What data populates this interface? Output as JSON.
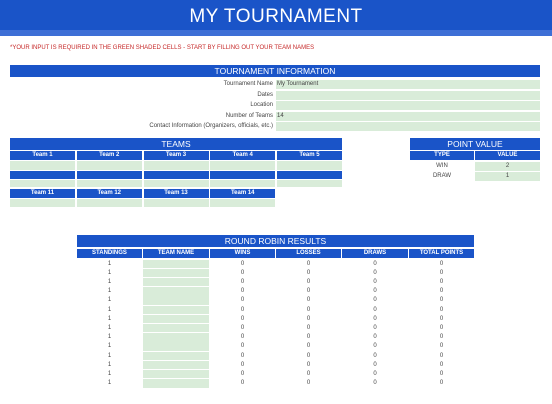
{
  "title": "MY TOURNAMENT",
  "instruction": "*YOUR INPUT IS REQUIRED IN THE GREEN SHADED CELLS - START BY FILLING OUT YOUR TEAM NAMES",
  "info": {
    "header": "TOURNAMENT INFORMATION",
    "rows": [
      {
        "label": "Tournament Name",
        "value": "My Tournament"
      },
      {
        "label": "Dates",
        "value": ""
      },
      {
        "label": "Location",
        "value": ""
      },
      {
        "label": "Number of Teams",
        "value": "14"
      },
      {
        "label": "Contact Information (Organizers, officials, etc.)",
        "value": ""
      }
    ]
  },
  "teams": {
    "header": "TEAMS",
    "row1": [
      "Team 1",
      "Team 2",
      "Team 3",
      "Team 4",
      "Team 5"
    ],
    "row3": [
      "Team 11",
      "Team 12",
      "Team 13",
      "Team 14"
    ]
  },
  "points": {
    "header": "POINT VALUE",
    "col_type": "TYPE",
    "col_value": "VALUE",
    "rows": [
      {
        "type": "WIN",
        "value": "2"
      },
      {
        "type": "DRAW",
        "value": "1"
      }
    ]
  },
  "results": {
    "header": "ROUND ROBIN RESULTS",
    "columns": [
      "STANDINGS",
      "TEAM NAME",
      "WINS",
      "LOSSES",
      "DRAWS",
      "TOTAL POINTS"
    ],
    "rows": [
      [
        "1",
        "",
        "0",
        "0",
        "0",
        "0"
      ],
      [
        "1",
        "",
        "0",
        "0",
        "0",
        "0"
      ],
      [
        "1",
        "",
        "0",
        "0",
        "0",
        "0"
      ],
      [
        "1",
        "",
        "0",
        "0",
        "0",
        "0"
      ],
      [
        "1",
        "",
        "0",
        "0",
        "0",
        "0"
      ],
      [
        "1",
        "",
        "0",
        "0",
        "0",
        "0"
      ],
      [
        "1",
        "",
        "0",
        "0",
        "0",
        "0"
      ],
      [
        "1",
        "",
        "0",
        "0",
        "0",
        "0"
      ],
      [
        "1",
        "",
        "0",
        "0",
        "0",
        "0"
      ],
      [
        "1",
        "",
        "0",
        "0",
        "0",
        "0"
      ],
      [
        "1",
        "",
        "0",
        "0",
        "0",
        "0"
      ],
      [
        "1",
        "",
        "0",
        "0",
        "0",
        "0"
      ],
      [
        "1",
        "",
        "0",
        "0",
        "0",
        "0"
      ],
      [
        "1",
        "",
        "0",
        "0",
        "0",
        "0"
      ]
    ]
  }
}
